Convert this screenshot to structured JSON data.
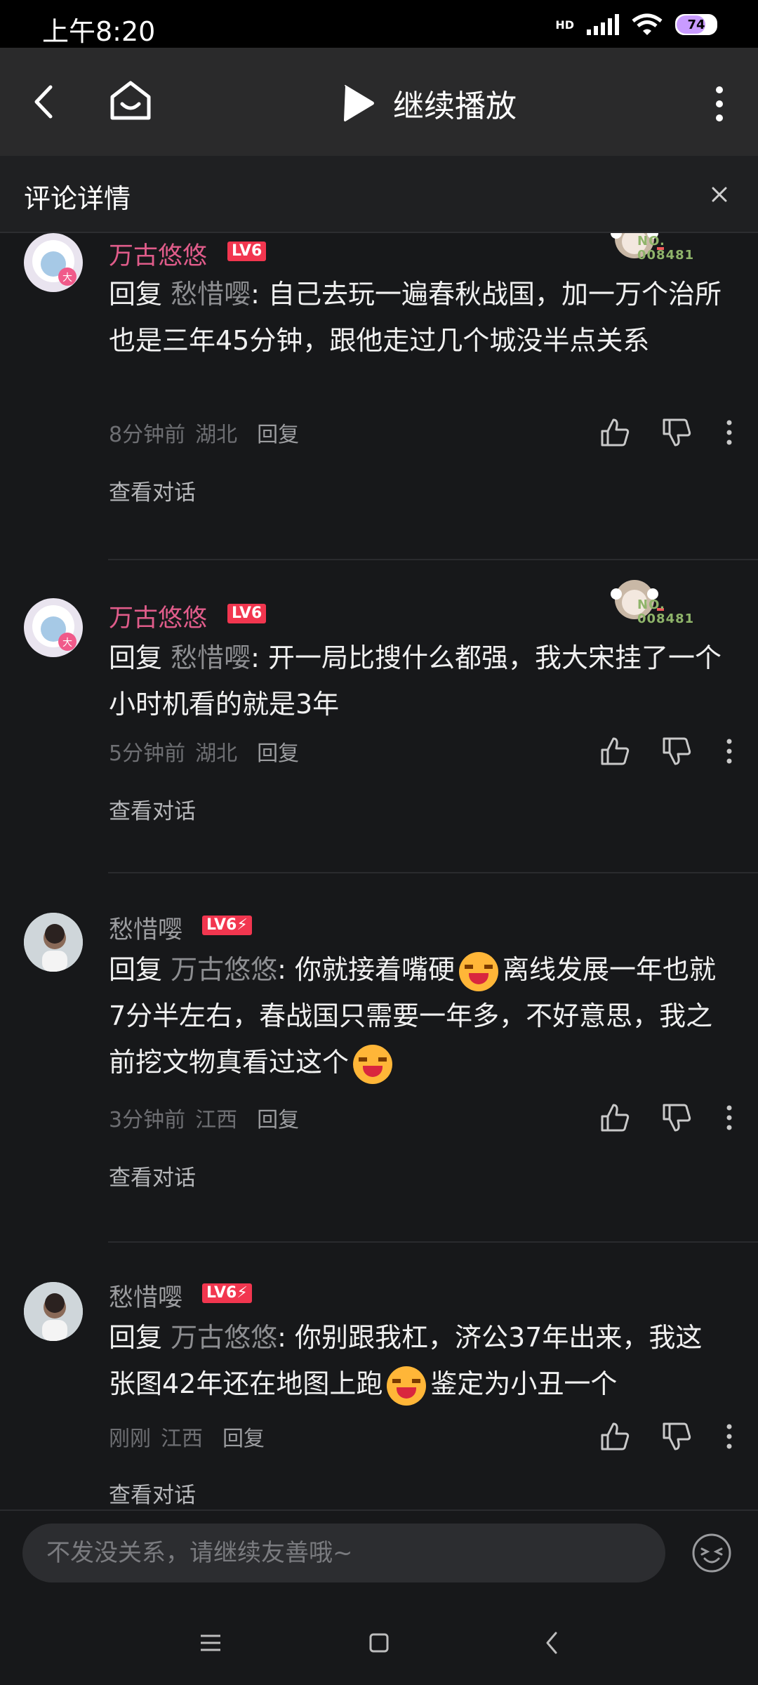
{
  "status_bar": {
    "time": "上午8:20",
    "network_badge": "HD",
    "battery_level": "74"
  },
  "top_bar": {
    "back_icon": "chevron-left-icon",
    "home_icon": "tv-home-icon",
    "play_icon": "play-icon",
    "play_label": "继续播放",
    "more_icon": "more-vertical-icon"
  },
  "panel": {
    "title": "评论详情",
    "close_icon": "close-icon"
  },
  "comments": [
    {
      "username": "万古悠悠",
      "username_color": "#e05c8a",
      "level": "LV6",
      "fan_no_label": "NO.",
      "fan_no_value": "008481",
      "reply_prefix": "回复",
      "reply_to": "愁惜嘤",
      "reply_sep": ":",
      "text": "自己去玩一遍春秋战国，加一万个治所也是三年45分钟，跟他走过几个城没半点关系",
      "time": "8分钟前",
      "location": "湖北",
      "reply_label": "回复",
      "view_conversation": "查看对话"
    },
    {
      "username": "万古悠悠",
      "username_color": "#e05c8a",
      "level": "LV6",
      "fan_no_label": "NO.",
      "fan_no_value": "008481",
      "reply_prefix": "回复",
      "reply_to": "愁惜嘤",
      "reply_sep": ":",
      "text": "开一局比搜什么都强，我大宋挂了一个小时机看的就是3年",
      "time": "5分钟前",
      "location": "湖北",
      "reply_label": "回复",
      "view_conversation": "查看对话"
    },
    {
      "username": "愁惜嘤",
      "username_color": "#9c9da0",
      "level": "LV6⚡",
      "reply_prefix": "回复",
      "reply_to": "万古悠悠",
      "reply_sep": ":",
      "text_a": "你就接着嘴硬",
      "text_b": "离线发展一年也就7分半左右，春战国只需要一年多，不好意思，我之前挖文物真看过这个",
      "time": "3分钟前",
      "location": "江西",
      "reply_label": "回复",
      "view_conversation": "查看对话"
    },
    {
      "username": "愁惜嘤",
      "username_color": "#9c9da0",
      "level": "LV6⚡",
      "reply_prefix": "回复",
      "reply_to": "万古悠悠",
      "reply_sep": ":",
      "text_a": "你别跟我杠，济公37年出来，我这张图42年还在地图上跑",
      "text_b": "鉴定为小丑一个",
      "time": "刚刚",
      "location": "江西",
      "reply_label": "回复",
      "view_conversation": "查看对话"
    }
  ],
  "input": {
    "placeholder": "不发没关系，请继续友善哦~",
    "emoji_icon": "emoji-face-icon"
  },
  "nav_bar": {
    "menu_icon": "menu-icon",
    "home_icon": "square-home-icon",
    "back_icon": "back-triangle-icon"
  },
  "colors": {
    "background": "#17181a",
    "topbar": "#2a2a2b",
    "level_badge": "#f2364f",
    "muted_text": "#8d8e91"
  }
}
